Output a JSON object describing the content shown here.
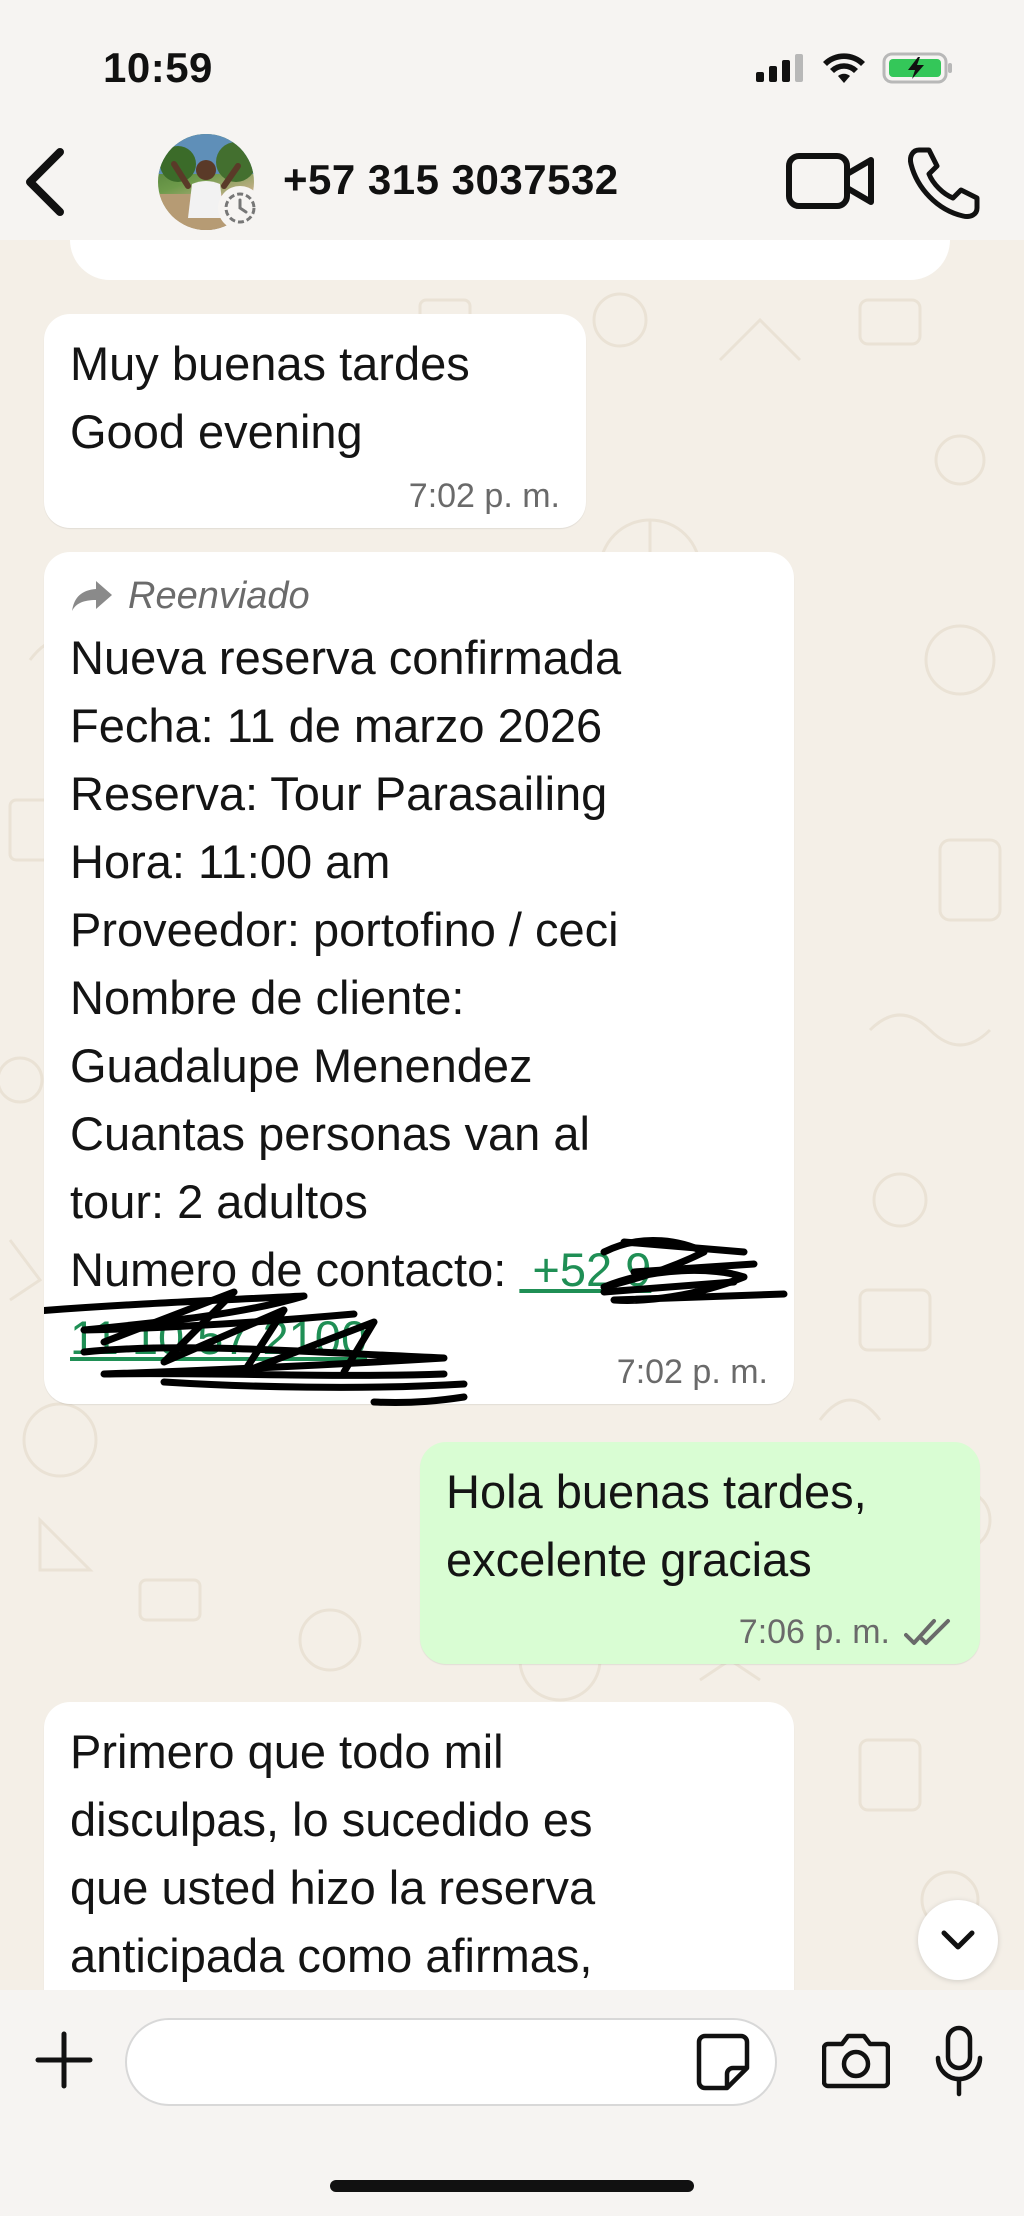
{
  "status_bar": {
    "time": "10:59"
  },
  "header": {
    "contact": "+57 315 3037532"
  },
  "messages": [
    {
      "lines": [
        "Muy buenas tardes",
        "Good evening"
      ],
      "time": "7:02 p. m."
    },
    {
      "forwarded_label": "Reenviado",
      "lines": [
        "Nueva reserva confirmada",
        "Fecha: 11 de marzo 2026",
        "Reserva: Tour Parasailing",
        "Hora: 11:00 am",
        "Proveedor: portofino / ceci",
        "Nombre de cliente:",
        "Guadalupe Menendez",
        "Cuantas personas van al",
        "tour: 2 adultos"
      ],
      "contact_label": "Numero de contacto:",
      "time": "7:02 p. m."
    },
    {
      "lines": [
        "Hola buenas tardes,",
        "excelente gracias"
      ],
      "time": "7:06 p. m."
    },
    {
      "lines": [
        "Primero que todo mil",
        "disculpas,  lo sucedido es",
        "que usted hizo la reserva",
        "anticipada como afirmas,"
      ]
    }
  ],
  "icons": {
    "back": "chevron-left-icon",
    "video": "video-camera-icon",
    "call": "phone-icon",
    "plus": "plus-icon",
    "sticker": "sticker-icon",
    "camera": "camera-icon",
    "mic": "microphone-icon",
    "scroll": "chevron-down-icon",
    "forward": "forward-arrow-icon",
    "read": "double-check-icon"
  },
  "colors": {
    "outgoing_bubble": "#d9fdd3",
    "incoming_bubble": "#ffffff",
    "chat_background": "#f4efe7",
    "battery_green": "#34c759",
    "link_green": "#1f8f55"
  }
}
